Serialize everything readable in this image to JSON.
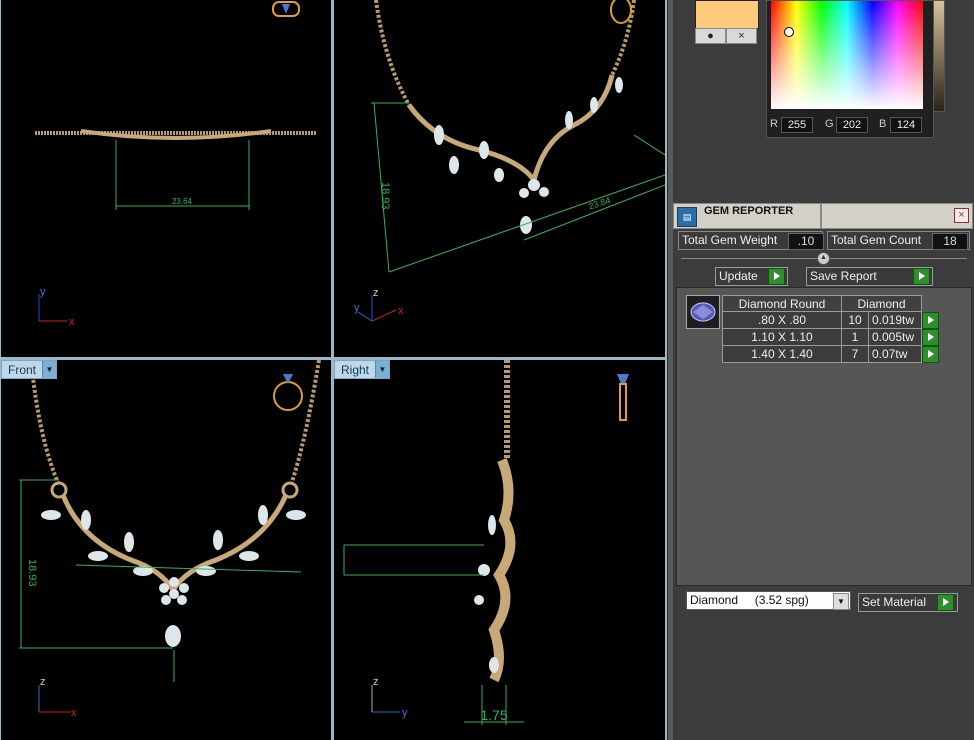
{
  "viewports": {
    "top": {
      "dimension": "23.64"
    },
    "perspective": {
      "dimension_a": "18.93",
      "dimension_b": "23.84"
    },
    "front": {
      "label": "Front",
      "dimension": "18.93"
    },
    "right": {
      "label": "Right",
      "dimension": "1.75"
    }
  },
  "axes": {
    "x": "x",
    "y": "y",
    "z": "z"
  },
  "color_picker": {
    "swatch_color": "#FFCA7C",
    "r_label": "R",
    "r_value": "255",
    "g_label": "G",
    "g_value": "202",
    "b_label": "B",
    "b_value": "124",
    "close_symbol": "×"
  },
  "gem_reporter": {
    "title": "GEM REPORTER",
    "total_weight_label": "Total Gem Weight",
    "total_weight_value": ".10",
    "total_count_label": "Total Gem Count",
    "total_count_value": "18",
    "update_label": "Update",
    "save_report_label": "Save Report",
    "table": {
      "headers": [
        "Diamond Round",
        "Diamond"
      ],
      "rows": [
        {
          "size": ".80 X .80",
          "count": "10",
          "weight": "0.019tw"
        },
        {
          "size": "1.10 X 1.10",
          "count": "1",
          "weight": "0.005tw"
        },
        {
          "size": "1.40 X 1.40",
          "count": "7",
          "weight": "0.07tw"
        }
      ]
    },
    "material_select": "Diamond     (3.52 spg)",
    "set_material_label": "Set Material"
  },
  "colors": {
    "gold": "#c9a878",
    "dimension_line": "#2fb35a",
    "label_bg": "#bcd8ea"
  }
}
